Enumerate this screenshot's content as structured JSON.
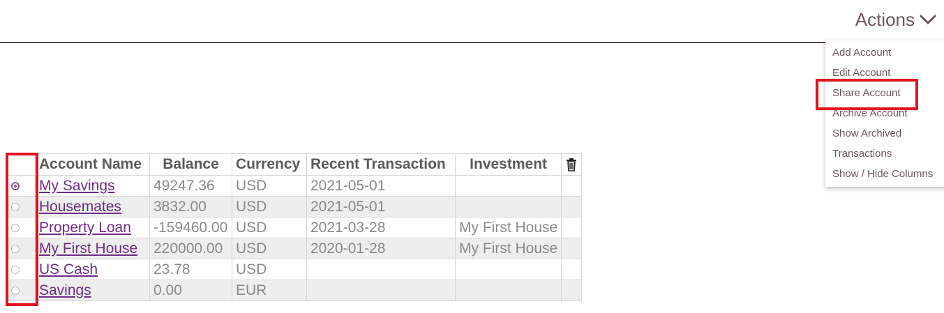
{
  "actions_menu": {
    "label": "Actions",
    "items": [
      {
        "label": "Add Account"
      },
      {
        "label": "Edit Account"
      },
      {
        "label": "Share Account"
      },
      {
        "label": "Archive Account"
      },
      {
        "label": "Show Archived"
      },
      {
        "label": "Transactions"
      },
      {
        "label": "Show / Hide Columns"
      }
    ]
  },
  "accounts_table": {
    "columns": [
      "Account Name",
      "Balance",
      "Currency",
      "Recent Transaction",
      "Investment"
    ],
    "delete_icon": "trash-icon",
    "rows": [
      {
        "selected": true,
        "name": "My Savings",
        "balance": "49247.36",
        "currency": "USD",
        "recent": "2021-05-01",
        "investment": ""
      },
      {
        "selected": false,
        "name": "Housemates",
        "balance": "3832.00",
        "currency": "USD",
        "recent": "2021-05-01",
        "investment": ""
      },
      {
        "selected": false,
        "name": "Property Loan",
        "balance": "-159460.00",
        "currency": "USD",
        "recent": "2021-03-28",
        "investment": "My First House"
      },
      {
        "selected": false,
        "name": "My First House",
        "balance": "220000.00",
        "currency": "USD",
        "recent": "2020-01-28",
        "investment": "My First House"
      },
      {
        "selected": false,
        "name": "US Cash",
        "balance": "23.78",
        "currency": "USD",
        "recent": "",
        "investment": ""
      },
      {
        "selected": false,
        "name": "Savings",
        "balance": "0.00",
        "currency": "EUR",
        "recent": "",
        "investment": ""
      }
    ]
  },
  "colors": {
    "accent": "#6f2d86",
    "rule": "#5b4450",
    "highlight": "#e0141e"
  }
}
